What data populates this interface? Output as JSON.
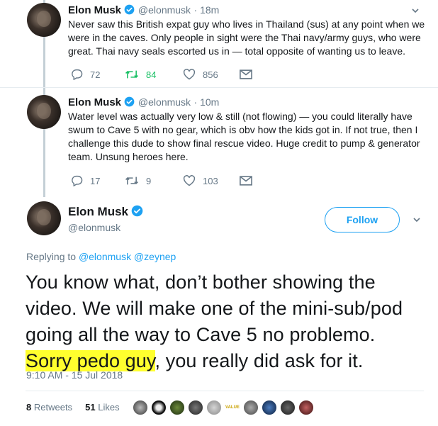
{
  "tweets": [
    {
      "name": "Elon Musk",
      "handle": "@elonmusk",
      "time": "· 18m",
      "text_lines": [
        "Never saw this British expat guy who lives in Thailand (sus) at any point when we",
        "were in the caves. Only people in sight were the Thai navy/army guys, who were",
        "great. Thai navy seals escorted us in — total opposite of wanting us to leave."
      ],
      "replies": "72",
      "retweets": "84",
      "likes": "856"
    },
    {
      "name": "Elon Musk",
      "handle": "@elonmusk",
      "time": "· 10m",
      "text_lines": [
        "Water level was actually very low & still (not flowing) — you could literally have",
        "swum to Cave 5 with no gear, which is obv how the kids got in. If not true, then I",
        "challenge this dude to show final rescue video. Huge credit to pump & generator",
        "team. Unsung heroes here."
      ],
      "replies": "17",
      "retweets": "9",
      "likes": "103"
    }
  ],
  "main": {
    "name": "Elon Musk",
    "handle": "@elonmusk",
    "follow_label": "Follow",
    "replying_prefix": "Replying to",
    "replying_to": "@elonmusk @zeynep",
    "text_lines": [
      "You know what, don’t bother showing the",
      "video. We will make one of the mini-sub/pod",
      "going all the way to Cave 5 no problemo."
    ],
    "last_line_highlight": "Sorry pedo guy",
    "last_line_rest": ", you really did ask for it.",
    "timestamp": "9:10 AM - 15 Jul 2018",
    "retweets_count": "8",
    "retweets_label": "Retweets",
    "likes_count": "51",
    "likes_label": "Likes",
    "liker_logo_text": "VALUE"
  },
  "colors": {
    "accent": "#1da1f2",
    "retweet": "#17bf63",
    "muted": "#657786",
    "highlight": "#ffff2e"
  }
}
